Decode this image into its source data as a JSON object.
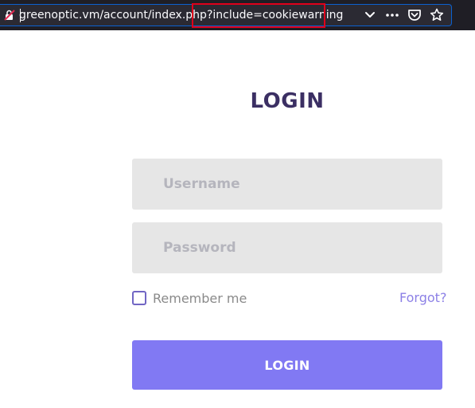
{
  "browser": {
    "url_base": "greenoptic.vm/account/index.php",
    "url_query": "?include=cookiewarning",
    "icons": [
      "insecure-connection-icon",
      "chevron-down-icon",
      "more-dots-icon",
      "pocket-icon",
      "bookmark-star-icon"
    ],
    "colors": {
      "toolbar": "#1f1e25",
      "field": "#2b2a33",
      "focus": "#0b61d1",
      "highlight_box": "#e0001b"
    }
  },
  "page": {
    "title": "LOGIN",
    "username_placeholder": "Username",
    "password_placeholder": "Password",
    "remember_label": "Remember me",
    "forgot_label": "Forgot?",
    "login_button": "LOGIN",
    "colors": {
      "title": "#3b2f63",
      "accent": "#8179f3",
      "field_bg": "#e6e6e6",
      "link": "#8c80e6"
    }
  }
}
